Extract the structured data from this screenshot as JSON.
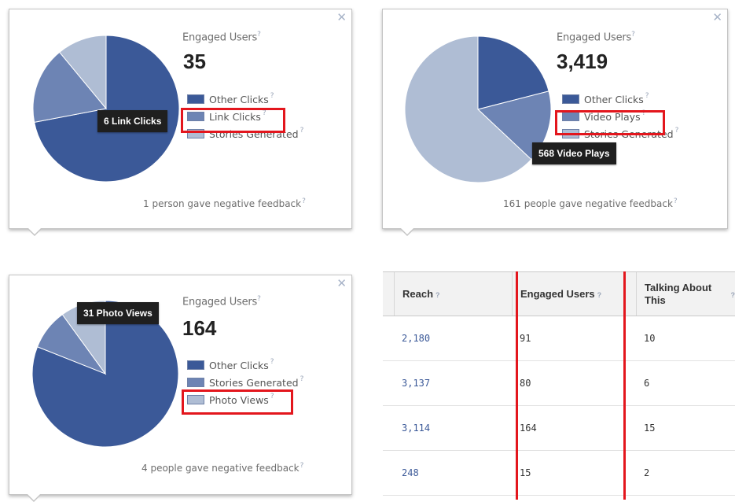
{
  "colors": {
    "dark_blue": "#3b5998",
    "mid_blue": "#6d84b4",
    "light_blue": "#afbdd4",
    "highlight_red": "#e3161d"
  },
  "panel_a": {
    "engaged_label": "Engaged Users",
    "engaged_value": "35",
    "legend": [
      "Other Clicks",
      "Link Clicks",
      "Stories Generated"
    ],
    "tooltip": "6 Link Clicks",
    "negative_feedback": "1 person gave negative feedback",
    "pie": {
      "slices": [
        {
          "name": "Other Clicks",
          "value": 0.72
        },
        {
          "name": "Link Clicks",
          "value": 0.17
        },
        {
          "name": "Stories Generated",
          "value": 0.11
        }
      ]
    }
  },
  "panel_b": {
    "engaged_label": "Engaged Users",
    "engaged_value": "3,419",
    "legend": [
      "Other Clicks",
      "Video Plays",
      "Stories Generated"
    ],
    "tooltip": "568 Video Plays",
    "negative_feedback": "161 people gave negative feedback",
    "pie": {
      "slices": [
        {
          "name": "Other Clicks",
          "value": 0.21
        },
        {
          "name": "Video Plays",
          "value": 0.16
        },
        {
          "name": "Stories Generated",
          "value": 0.63
        }
      ]
    }
  },
  "panel_c": {
    "engaged_label": "Engaged Users",
    "engaged_value": "164",
    "legend": [
      "Other Clicks",
      "Stories Generated",
      "Photo Views"
    ],
    "tooltip": "31 Photo Views",
    "negative_feedback": "4 people gave negative feedback",
    "pie": {
      "slices": [
        {
          "name": "Other Clicks",
          "value": 0.81
        },
        {
          "name": "Stories Generated",
          "value": 0.09
        },
        {
          "name": "Photo Views",
          "value": 0.1
        }
      ]
    }
  },
  "table": {
    "headers": [
      "Reach",
      "Engaged Users",
      "Talking About This"
    ],
    "rows": [
      [
        "2,180",
        "91",
        "10"
      ],
      [
        "3,137",
        "80",
        "6"
      ],
      [
        "3,114",
        "164",
        "15"
      ],
      [
        "248",
        "15",
        "2"
      ]
    ]
  }
}
